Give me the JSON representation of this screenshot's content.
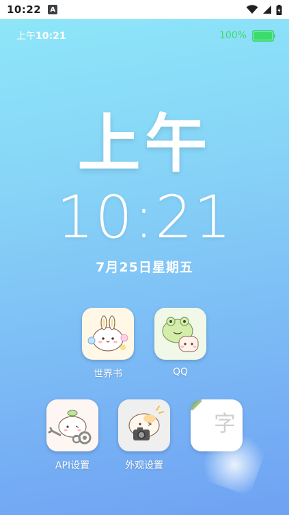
{
  "system_bar": {
    "time": "10:22",
    "notification": "A"
  },
  "app_bar": {
    "ampm": "上午",
    "time": "10:21",
    "battery_pct": "100%",
    "battery_level": 1.0
  },
  "clock": {
    "ampm": "上午",
    "time": "10:21",
    "date": "7月25日星期五"
  },
  "apps": [
    {
      "label": "世界书",
      "icon": "bunny-sticker-icon"
    },
    {
      "label": "QQ",
      "icon": "frog-sticker-icon"
    },
    {
      "label": "API设置",
      "icon": "wrench-gear-sticker-icon"
    },
    {
      "label": "外观设置",
      "icon": "camera-sticker-icon"
    },
    {
      "label": "",
      "icon": "font-icon",
      "glyph": "字"
    }
  ],
  "colors": {
    "battery": "#3ddc6a",
    "background_top": "#8ee6f8",
    "background_bottom": "#6fa2f3"
  }
}
